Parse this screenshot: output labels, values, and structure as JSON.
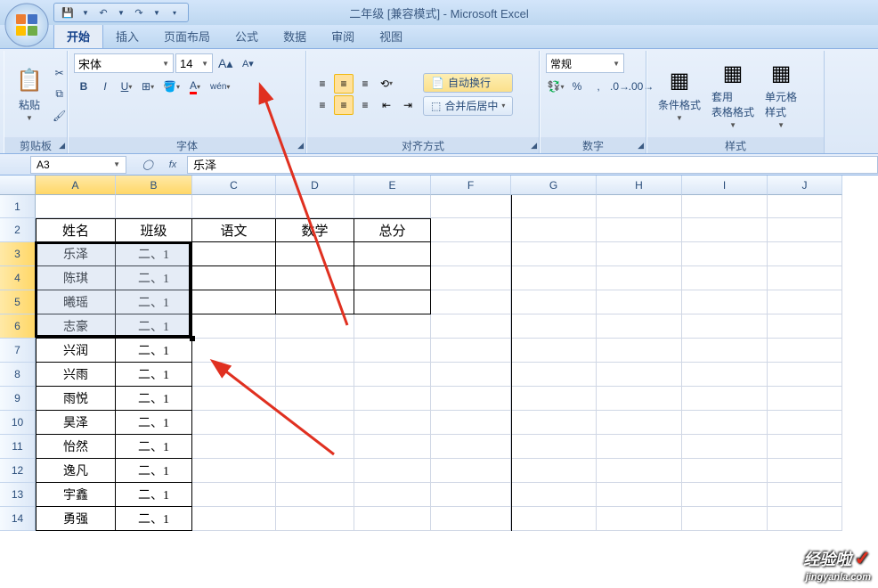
{
  "title": "二年级  [兼容模式] - Microsoft Excel",
  "tabs": [
    "开始",
    "插入",
    "页面布局",
    "公式",
    "数据",
    "审阅",
    "视图"
  ],
  "ribbon": {
    "clipboard": {
      "paste": "粘贴",
      "label": "剪贴板"
    },
    "font": {
      "name": "宋体",
      "size": "14",
      "label": "字体"
    },
    "align": {
      "wrap": "自动换行",
      "merge": "合并后居中",
      "label": "对齐方式"
    },
    "number": {
      "format": "常规",
      "label": "数字"
    },
    "styles": {
      "cond": "条件格式",
      "table": "套用\n表格格式",
      "cellst": "单元格\n样式",
      "label": "样式"
    }
  },
  "namebox": "A3",
  "formula": "乐泽",
  "cols": [
    {
      "l": "A",
      "w": 90
    },
    {
      "l": "B",
      "w": 86
    },
    {
      "l": "C",
      "w": 94
    },
    {
      "l": "D",
      "w": 88
    },
    {
      "l": "E",
      "w": 86
    },
    {
      "l": "F",
      "w": 90
    },
    {
      "l": "G",
      "w": 96
    },
    {
      "l": "H",
      "w": 96
    },
    {
      "l": "I",
      "w": 96
    },
    {
      "l": "J",
      "w": 84
    }
  ],
  "rows": [
    {
      "n": 1,
      "h": 26
    },
    {
      "n": 2,
      "h": 27
    },
    {
      "n": 3,
      "h": 27
    },
    {
      "n": 4,
      "h": 27
    },
    {
      "n": 5,
      "h": 27
    },
    {
      "n": 6,
      "h": 27
    },
    {
      "n": 7,
      "h": 27
    },
    {
      "n": 8,
      "h": 27
    },
    {
      "n": 9,
      "h": 27
    },
    {
      "n": 10,
      "h": 27
    },
    {
      "n": 11,
      "h": 27
    },
    {
      "n": 12,
      "h": 27
    },
    {
      "n": 13,
      "h": 27
    },
    {
      "n": 14,
      "h": 27
    }
  ],
  "headers": {
    "A": "姓名",
    "B": "班级",
    "C": "语文",
    "D": "数学",
    "E": "总分"
  },
  "data": [
    {
      "name": "乐泽",
      "class": "二、1"
    },
    {
      "name": "陈琪",
      "class": "二、1"
    },
    {
      "name": "曦瑶",
      "class": "二、1"
    },
    {
      "name": "志豪",
      "class": "二、1"
    },
    {
      "name": "兴润",
      "class": "二、1"
    },
    {
      "name": "兴雨",
      "class": "二、1"
    },
    {
      "name": "雨悦",
      "class": "二、1"
    },
    {
      "name": "昊泽",
      "class": "二、1"
    },
    {
      "name": "怡然",
      "class": "二、1"
    },
    {
      "name": "逸凡",
      "class": "二、1"
    },
    {
      "name": "宇鑫",
      "class": "二、1"
    },
    {
      "name": "勇强",
      "class": "二、1"
    }
  ],
  "watermark": {
    "t1": "经验啦",
    "t2": "jingyanla.com",
    "chk": "✓"
  }
}
